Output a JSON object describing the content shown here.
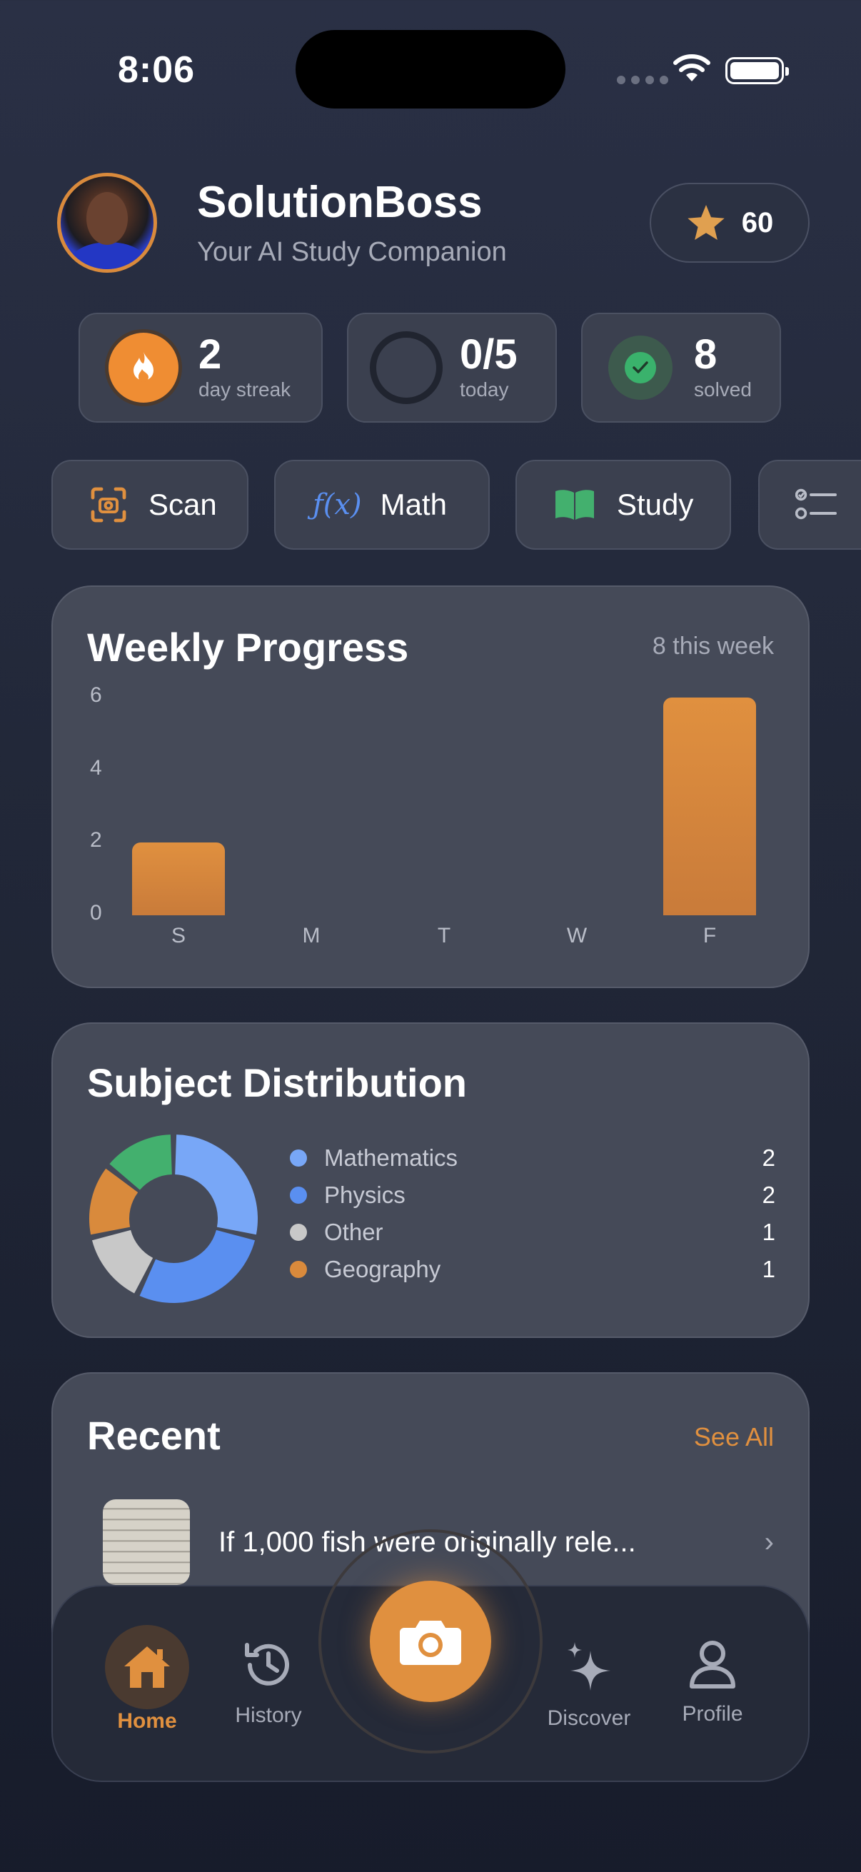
{
  "status_bar": {
    "time": "8:06"
  },
  "header": {
    "title": "SolutionBoss",
    "subtitle": "Your AI Study Companion",
    "points": "60"
  },
  "stats": {
    "streak": {
      "value": "2",
      "label": "day streak"
    },
    "today": {
      "value": "0/5",
      "label": "today"
    },
    "solved": {
      "value": "8",
      "label": "solved"
    }
  },
  "quick_actions": [
    {
      "label": "Scan",
      "icon": "scan-icon"
    },
    {
      "label": "Math",
      "icon": "function-icon"
    },
    {
      "label": "Study",
      "icon": "book-icon"
    },
    {
      "label": "",
      "icon": "checklist-icon"
    }
  ],
  "weekly": {
    "title": "Weekly Progress",
    "count_label": "8 this week"
  },
  "chart_data": {
    "type": "bar",
    "title": "Weekly Progress",
    "categories": [
      "S",
      "M",
      "T",
      "W",
      "F"
    ],
    "values": [
      2,
      0,
      0,
      0,
      6
    ],
    "yticks": [
      "0",
      "2",
      "4",
      "6"
    ],
    "ylim": [
      0,
      6
    ],
    "xlabel": "",
    "ylabel": "",
    "grid": false,
    "bar_color": "#d98a3c"
  },
  "distribution": {
    "title": "Subject Distribution",
    "items": [
      {
        "name": "Mathematics",
        "count": "2",
        "color": "#78a7f7"
      },
      {
        "name": "Physics",
        "count": "2",
        "color": "#5a8ff0"
      },
      {
        "name": "Other",
        "count": "1",
        "color": "#c8c8c8"
      },
      {
        "name": "Geography",
        "count": "1",
        "color": "#d98a3c"
      }
    ],
    "donut_segments": [
      {
        "name": "Mathematics",
        "value": 2,
        "color": "#78a7f7"
      },
      {
        "name": "Physics",
        "value": 2,
        "color": "#5a8ff0"
      },
      {
        "name": "Other",
        "value": 1,
        "color": "#c8c8c8"
      },
      {
        "name": "Geography",
        "value": 1,
        "color": "#d98a3c"
      },
      {
        "name": "Green",
        "value": 1,
        "color": "#43b06e"
      }
    ]
  },
  "recent": {
    "title": "Recent",
    "see_all": "See All",
    "items": [
      {
        "text": "If 1,000 fish were originally rele..."
      }
    ]
  },
  "nav": {
    "home": "Home",
    "history": "History",
    "discover": "Discover",
    "profile": "Profile"
  },
  "colors": {
    "accent": "#e0903f",
    "success": "#3ab26c",
    "card": "#454a58"
  }
}
